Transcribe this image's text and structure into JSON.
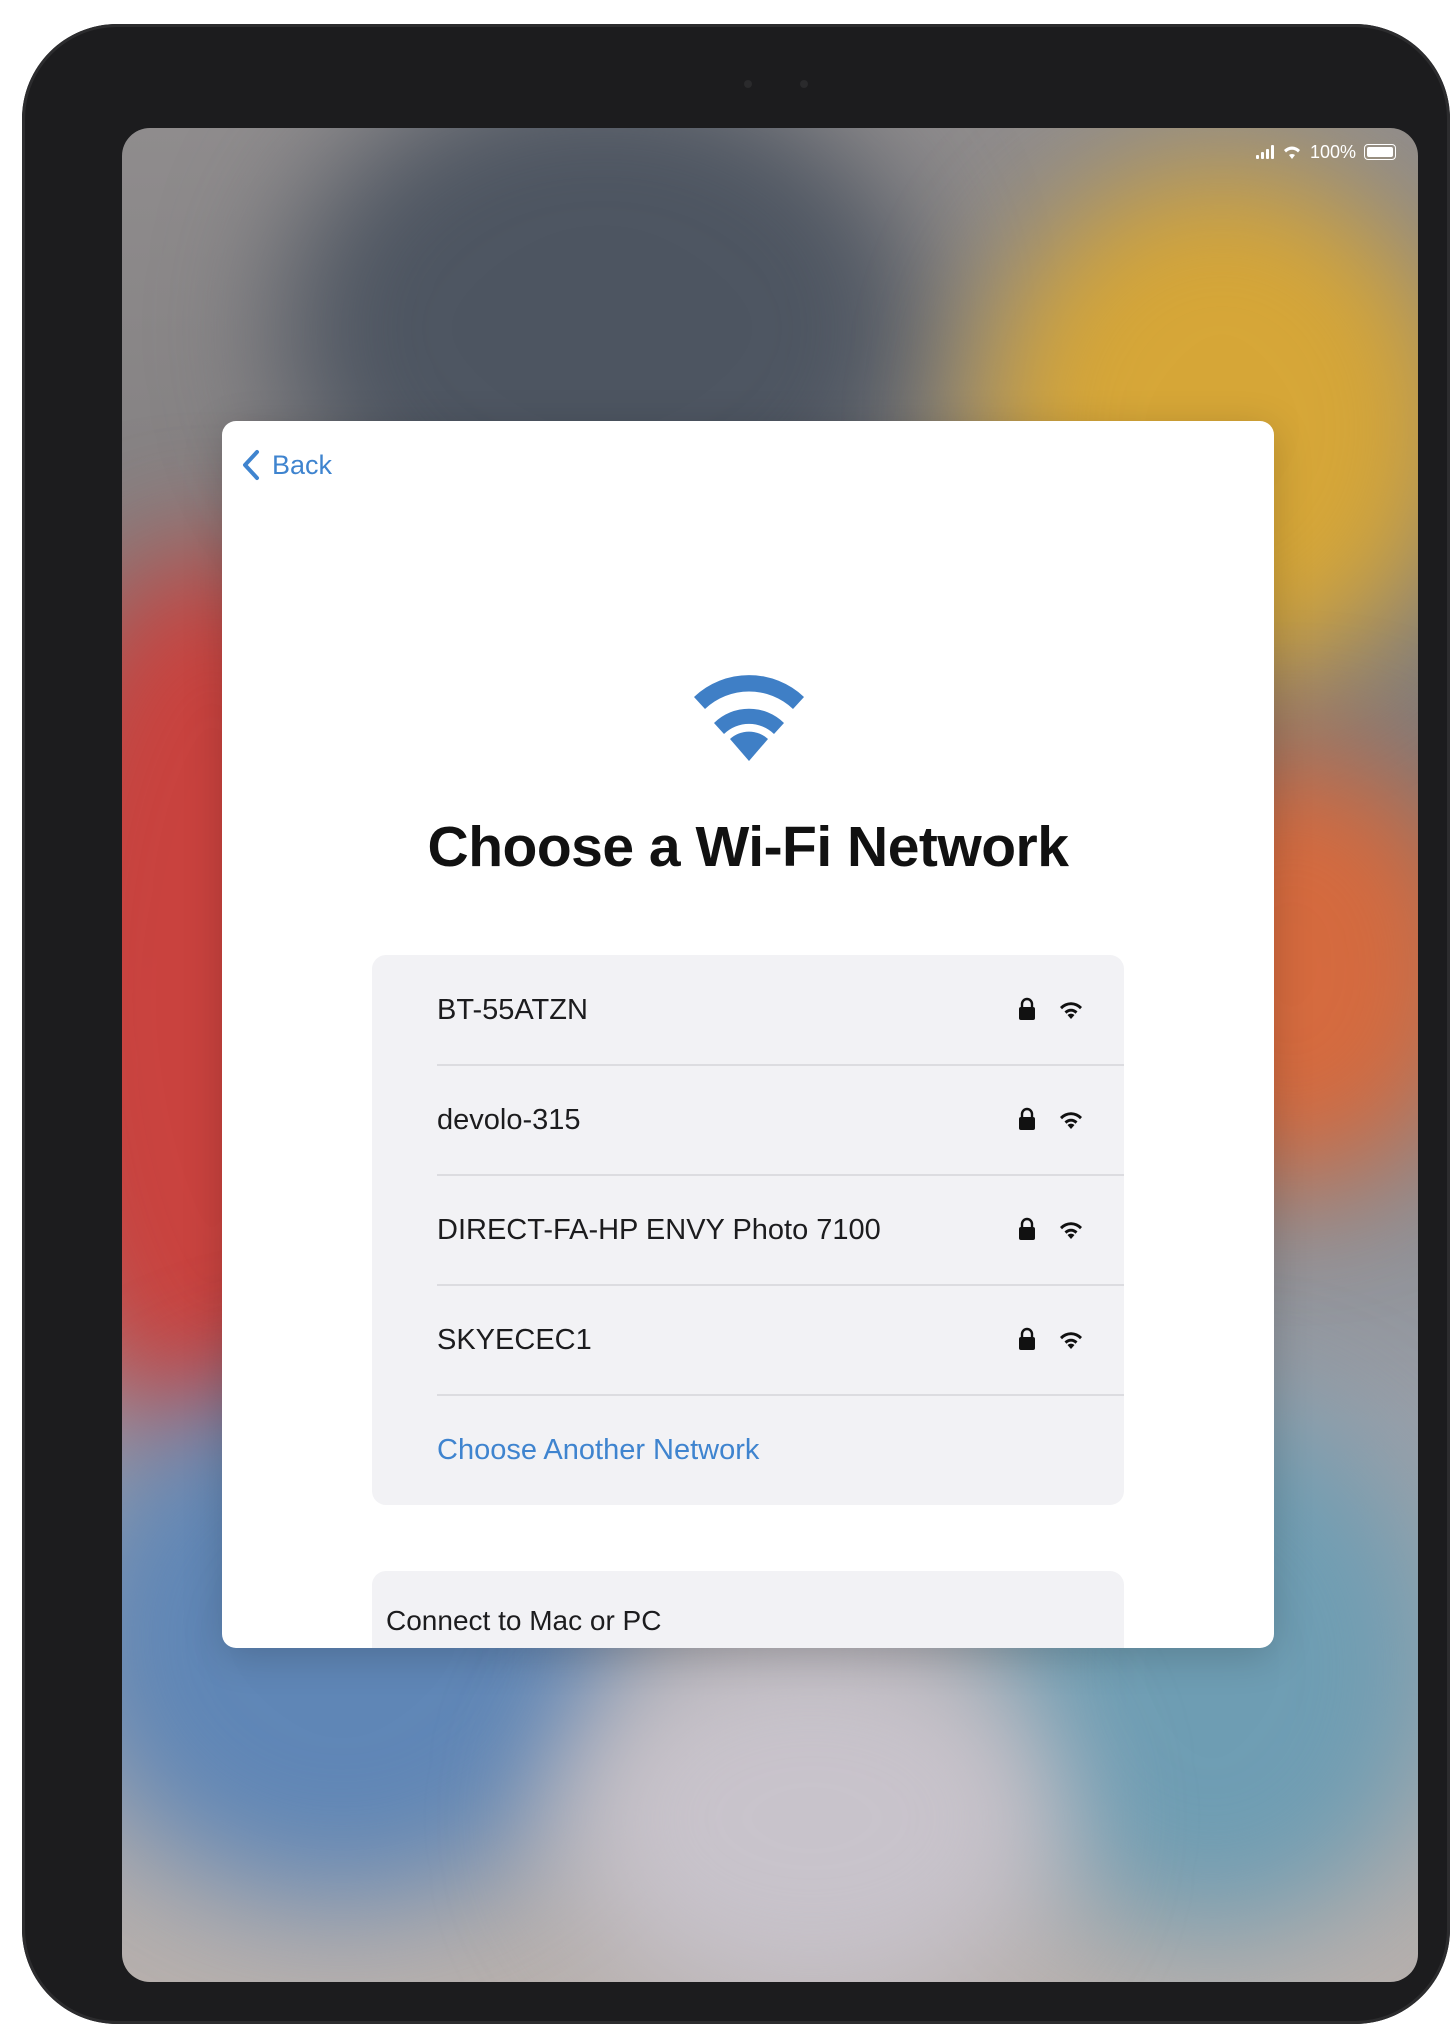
{
  "status_bar": {
    "battery": "100%"
  },
  "setup": {
    "back_label": "Back",
    "title": "Choose a Wi-Fi Network",
    "networks": [
      {
        "name": "BT-55ATZN",
        "secured": true
      },
      {
        "name": "devolo-315",
        "secured": true
      },
      {
        "name": "DIRECT-FA-HP ENVY Photo 7100",
        "secured": true
      },
      {
        "name": "SKYECEC1",
        "secured": true
      }
    ],
    "choose_another_label": "Choose Another Network",
    "connect_label": "Connect to Mac or PC"
  },
  "colors": {
    "accent": "#3f84cf",
    "wifi_hero": "#3f7fc6"
  },
  "icons": {
    "back": "chevron-left-icon",
    "hero": "wifi-icon",
    "row_lock": "lock-icon",
    "row_signal": "wifi-signal-icon"
  }
}
